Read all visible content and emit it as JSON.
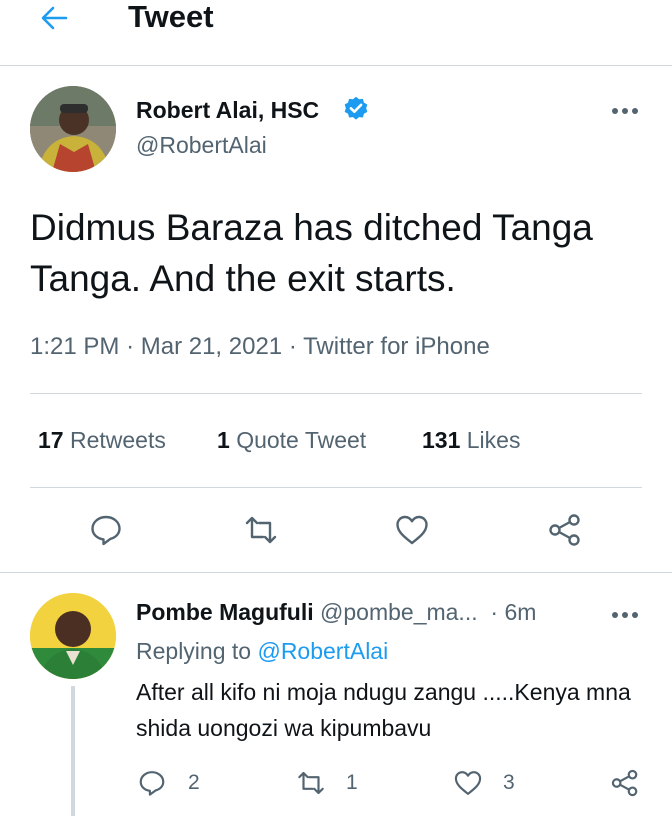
{
  "header": {
    "title": "Tweet",
    "back_icon": "arrow-left-icon"
  },
  "tweet": {
    "author_name": "Robert Alai, HSC",
    "author_handle": "@RobertAlai",
    "verified": true,
    "text": "Didmus Baraza has ditched Tanga Tanga. And the exit starts.",
    "time": "1:21 PM",
    "date": "Mar 21, 2021",
    "source": "Twitter for iPhone",
    "stats": {
      "retweets_count": "17",
      "retweets_label": "Retweets",
      "quotes_count": "1",
      "quotes_label": "Quote Tweet",
      "likes_count": "131",
      "likes_label": "Likes"
    },
    "actions": [
      "reply-icon",
      "retweet-icon",
      "like-icon",
      "share-icon"
    ]
  },
  "reply": {
    "author_name": "Pombe Magufuli",
    "author_handle": "@pombe_ma...",
    "time": "6m",
    "replying_label": "Replying to",
    "replying_to": "@RobertAlai",
    "text": "After all kifo ni moja ndugu zangu .....Kenya mna shida uongozi wa kipumbavu",
    "reply_count": "2",
    "retweet_count": "1",
    "like_count": "3"
  },
  "colors": {
    "accent": "#1d9bf0",
    "text": "#0f1419",
    "secondary": "#536471",
    "border": "#cfd9de"
  }
}
